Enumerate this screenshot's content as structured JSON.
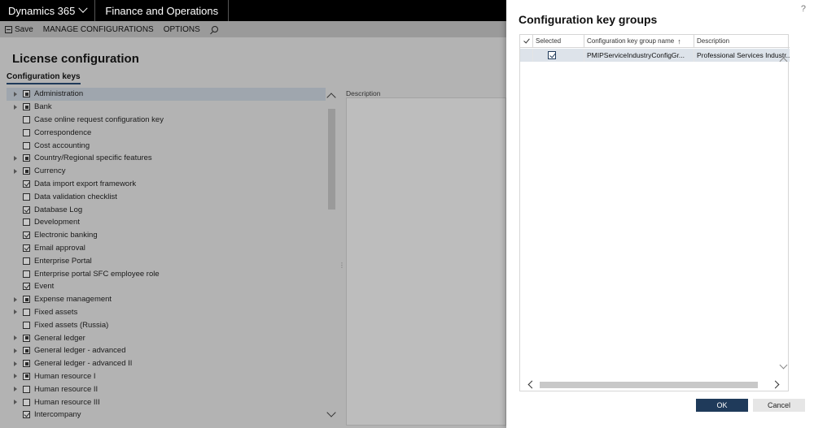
{
  "topbar": {
    "brand": "Dynamics 365",
    "product": "Finance and Operations"
  },
  "actionbar": {
    "save": "Save",
    "manage": "MANAGE CONFIGURATIONS",
    "options": "OPTIONS"
  },
  "page": {
    "title": "License configuration",
    "tab": "Configuration keys",
    "description_label": "Description",
    "tree": [
      {
        "label": "Administration",
        "expand": true,
        "state": "partial",
        "selected": true
      },
      {
        "label": "Bank",
        "expand": true,
        "state": "partial"
      },
      {
        "label": "Case online request configuration key",
        "expand": false,
        "state": "unchecked"
      },
      {
        "label": "Correspondence",
        "expand": false,
        "state": "unchecked"
      },
      {
        "label": "Cost accounting",
        "expand": false,
        "state": "unchecked"
      },
      {
        "label": "Country/Regional specific features",
        "expand": true,
        "state": "partial"
      },
      {
        "label": "Currency",
        "expand": true,
        "state": "partial"
      },
      {
        "label": "Data import export framework",
        "expand": false,
        "state": "checked"
      },
      {
        "label": "Data validation checklist",
        "expand": false,
        "state": "unchecked"
      },
      {
        "label": "Database Log",
        "expand": false,
        "state": "checked"
      },
      {
        "label": "Development",
        "expand": false,
        "state": "unchecked"
      },
      {
        "label": "Electronic banking",
        "expand": false,
        "state": "checked"
      },
      {
        "label": "Email approval",
        "expand": false,
        "state": "checked"
      },
      {
        "label": "Enterprise Portal",
        "expand": false,
        "state": "unchecked"
      },
      {
        "label": "Enterprise portal SFC employee role",
        "expand": false,
        "state": "unchecked"
      },
      {
        "label": "Event",
        "expand": false,
        "state": "checked"
      },
      {
        "label": "Expense management",
        "expand": true,
        "state": "partial"
      },
      {
        "label": "Fixed assets",
        "expand": true,
        "state": "unchecked"
      },
      {
        "label": "Fixed assets (Russia)",
        "expand": false,
        "state": "unchecked"
      },
      {
        "label": "General ledger",
        "expand": true,
        "state": "partial"
      },
      {
        "label": "General ledger - advanced",
        "expand": true,
        "state": "partial"
      },
      {
        "label": "General ledger - advanced II",
        "expand": true,
        "state": "partial"
      },
      {
        "label": "Human resource I",
        "expand": true,
        "state": "partial"
      },
      {
        "label": "Human resource II",
        "expand": true,
        "state": "unchecked"
      },
      {
        "label": "Human resource III",
        "expand": true,
        "state": "unchecked"
      },
      {
        "label": "Intercompany",
        "expand": false,
        "state": "checked"
      }
    ]
  },
  "dialog": {
    "help": "?",
    "title": "Configuration key groups",
    "columns": {
      "selected": "Selected",
      "name": "Configuration key group name",
      "sort": "↑",
      "description": "Description"
    },
    "rows": [
      {
        "name": "PMIPServiceIndustryConfigGr...",
        "description": "Professional Services Industr..."
      }
    ],
    "ok": "OK",
    "cancel": "Cancel"
  }
}
